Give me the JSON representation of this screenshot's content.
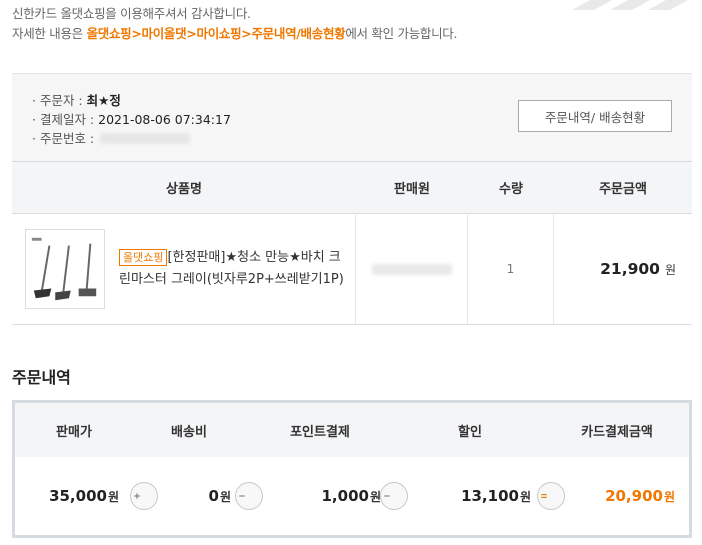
{
  "intro": {
    "line1": "신한카드 올댓쇼핑을 이용해주셔서 감사합니다.",
    "line2_prefix": "자세한 내용은 ",
    "line2_highlight": "올댓쇼핑>마이올댓>마이쇼핑>주문내역/배송현황",
    "line2_suffix": "에서 확인 가능합니다."
  },
  "order": {
    "orderer_label": "· 주문자 :",
    "orderer_value": "최★정",
    "date_label": "· 결제일자 :",
    "date_value": "2021-08-06 07:34:17",
    "number_label": "· 주문번호 :",
    "track_button": "주문내역/ 배송현황"
  },
  "product_table": {
    "headers": [
      "상품명",
      "판매원",
      "수량",
      "주문금액"
    ],
    "rows": [
      {
        "badge": "올댓쇼핑",
        "name": "[한정판매]★청소 만능★바치 크린마스터 그레이(빗자루2P+쓰레받기1P)",
        "quantity": "1",
        "amount": "21,900",
        "unit": "원"
      }
    ]
  },
  "summary": {
    "title": "주문내역",
    "headers": [
      "판매가",
      "배송비",
      "포인트결제",
      "할인",
      "카드결제금액"
    ],
    "values": [
      "35,000",
      "0",
      "1,000",
      "13,100",
      "20,900"
    ],
    "unit": "원",
    "operators": [
      "plus-icon",
      "minus-icon",
      "minus-icon",
      "equals-icon"
    ],
    "accent_color": "#f07800"
  }
}
